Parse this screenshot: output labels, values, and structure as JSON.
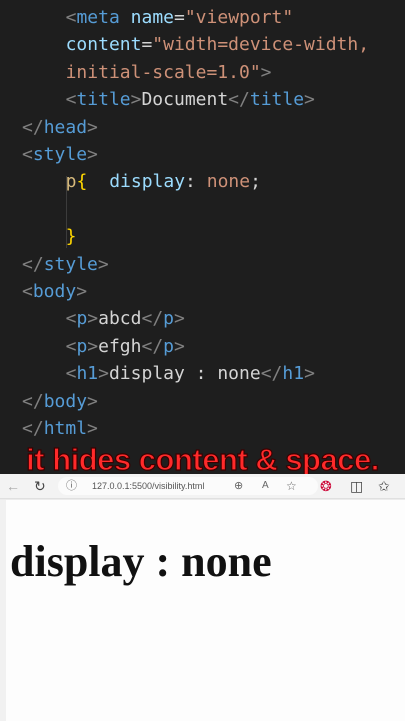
{
  "editor": {
    "lines": [
      {
        "i": "    ",
        "parts": [
          {
            "c": "tagc",
            "t": "<"
          },
          {
            "c": "tag",
            "t": "meta"
          },
          {
            "c": "txt",
            "t": " "
          },
          {
            "c": "attr",
            "t": "name"
          },
          {
            "c": "txt",
            "t": "="
          },
          {
            "c": "str",
            "t": "\"viewport\""
          }
        ]
      },
      {
        "i": "    ",
        "parts": [
          {
            "c": "attr",
            "t": "content"
          },
          {
            "c": "txt",
            "t": "="
          },
          {
            "c": "str",
            "t": "\"width=device-width,"
          }
        ]
      },
      {
        "i": "    ",
        "parts": [
          {
            "c": "str",
            "t": "initial-scale=1.0\""
          },
          {
            "c": "tagc",
            "t": ">"
          }
        ]
      },
      {
        "i": "    ",
        "parts": [
          {
            "c": "tagc",
            "t": "<"
          },
          {
            "c": "tag",
            "t": "title"
          },
          {
            "c": "tagc",
            "t": ">"
          },
          {
            "c": "txt",
            "t": "Document"
          },
          {
            "c": "tagc",
            "t": "</"
          },
          {
            "c": "tag",
            "t": "title"
          },
          {
            "c": "tagc",
            "t": ">"
          }
        ]
      },
      {
        "i": "",
        "parts": [
          {
            "c": "tagc",
            "t": "</"
          },
          {
            "c": "tag",
            "t": "head"
          },
          {
            "c": "tagc",
            "t": ">"
          }
        ]
      },
      {
        "i": "",
        "parts": [
          {
            "c": "tagc",
            "t": "<"
          },
          {
            "c": "tag",
            "t": "style"
          },
          {
            "c": "tagc",
            "t": ">"
          }
        ]
      },
      {
        "i": "    ",
        "parts": [
          {
            "c": "sel",
            "t": "p"
          },
          {
            "c": "brace",
            "t": "{"
          }
        ]
      },
      {
        "i": "",
        "parts": []
      },
      {
        "i": "        ",
        "parts": [
          {
            "c": "prop",
            "t": "display"
          },
          {
            "c": "txt",
            "t": ": "
          },
          {
            "c": "val",
            "t": "none"
          },
          {
            "c": "txt",
            "t": ";"
          }
        ]
      },
      {
        "i": "",
        "parts": []
      },
      {
        "i": "    ",
        "parts": [
          {
            "c": "brace",
            "t": "}"
          }
        ]
      },
      {
        "i": "",
        "parts": [
          {
            "c": "tagc",
            "t": "</"
          },
          {
            "c": "tag",
            "t": "style"
          },
          {
            "c": "tagc",
            "t": ">"
          }
        ]
      },
      {
        "i": "",
        "parts": [
          {
            "c": "tagc",
            "t": "<"
          },
          {
            "c": "tag",
            "t": "body"
          },
          {
            "c": "tagc",
            "t": ">"
          }
        ]
      },
      {
        "i": "    ",
        "parts": [
          {
            "c": "tagc",
            "t": "<"
          },
          {
            "c": "tag",
            "t": "p"
          },
          {
            "c": "tagc",
            "t": ">"
          },
          {
            "c": "txt",
            "t": "abcd"
          },
          {
            "c": "tagc",
            "t": "</"
          },
          {
            "c": "tag",
            "t": "p"
          },
          {
            "c": "tagc",
            "t": ">"
          }
        ]
      },
      {
        "i": "    ",
        "parts": [
          {
            "c": "tagc",
            "t": "<"
          },
          {
            "c": "tag",
            "t": "p"
          },
          {
            "c": "tagc",
            "t": ">"
          },
          {
            "c": "txt",
            "t": "efgh"
          },
          {
            "c": "tagc",
            "t": "</"
          },
          {
            "c": "tag",
            "t": "p"
          },
          {
            "c": "tagc",
            "t": ">"
          }
        ]
      },
      {
        "i": "    ",
        "parts": [
          {
            "c": "tagc",
            "t": "<"
          },
          {
            "c": "tag",
            "t": "h1"
          },
          {
            "c": "tagc",
            "t": ">"
          },
          {
            "c": "txt",
            "t": "display : none"
          },
          {
            "c": "tagc",
            "t": "</"
          },
          {
            "c": "tag",
            "t": "h1"
          },
          {
            "c": "tagc",
            "t": ">"
          }
        ]
      },
      {
        "i": "",
        "parts": [
          {
            "c": "tagc",
            "t": "</"
          },
          {
            "c": "tag",
            "t": "body"
          },
          {
            "c": "tagc",
            "t": ">"
          }
        ]
      },
      {
        "i": "",
        "parts": [
          {
            "c": "tagc",
            "t": "</"
          },
          {
            "c": "tag",
            "t": "html"
          },
          {
            "c": "tagc",
            "t": ">"
          }
        ]
      }
    ]
  },
  "caption": "it hides content & space.",
  "browser": {
    "url": "127.0.0.1:5500/visibility.html",
    "heading": "display : none"
  },
  "colors": {
    "editor_bg": "#1e1e1e",
    "caption": "#ff2a2a",
    "tag": "#569cd6",
    "attr": "#9cdcfe",
    "string": "#ce9178"
  },
  "icons": [
    "back-arrow-icon",
    "reload-icon",
    "info-icon",
    "zoom-icon",
    "read-aloud-icon",
    "favorite-star-icon",
    "extensions-icon",
    "split-screen-icon",
    "favorites-icon"
  ]
}
